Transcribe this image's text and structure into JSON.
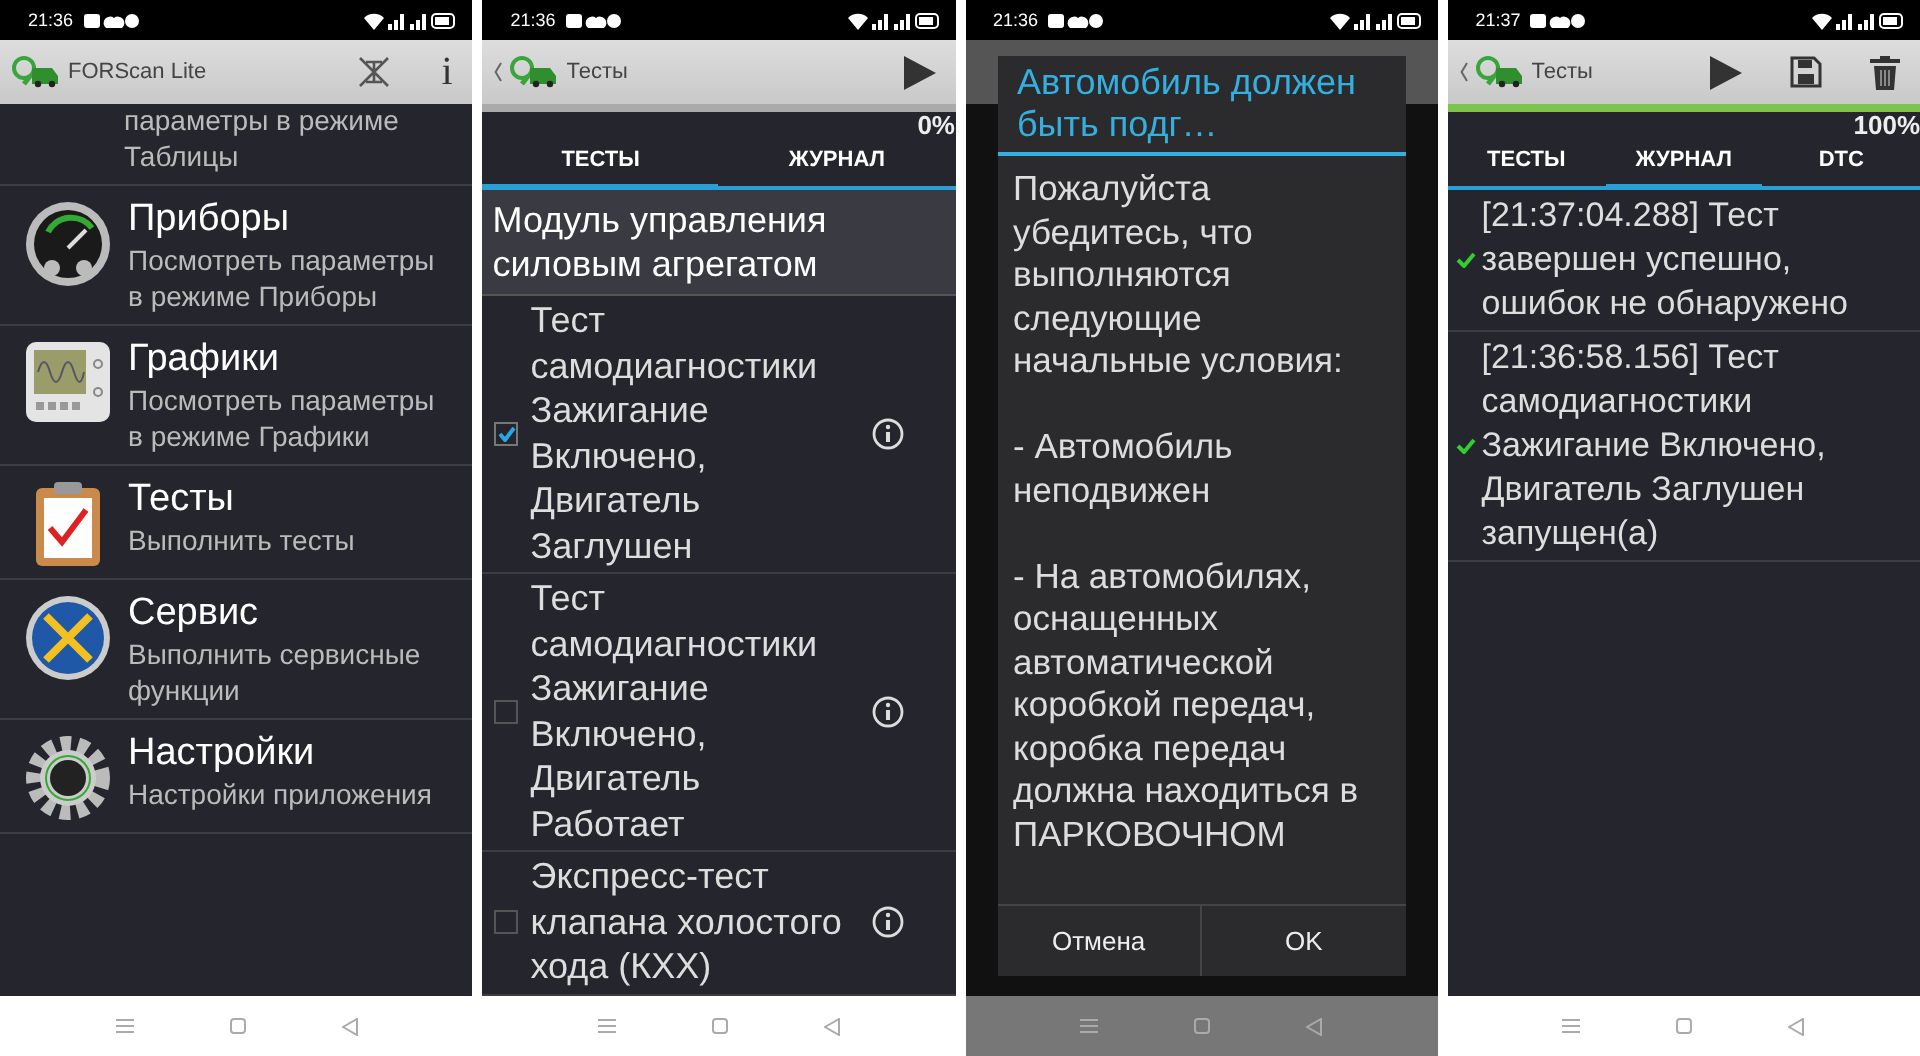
{
  "screens": [
    {
      "kind": "menu",
      "status_bar": {
        "time": "21:36"
      },
      "app_bar": {
        "title": "FORScan Lite",
        "info": "i"
      },
      "cut_text": "параметры в режиме Таблицы",
      "menu_items": [
        {
          "kind": "gauge",
          "title": "Приборы",
          "desc": "Посмотреть параметры в режиме Приборы"
        },
        {
          "kind": "scope",
          "title": "Графики",
          "desc": "Посмотреть параметры в режиме Графики"
        },
        {
          "kind": "clipboard",
          "title": "Тесты",
          "desc": "Выполнить тесты"
        },
        {
          "kind": "tools",
          "title": "Сервис",
          "desc": "Выполнить сервисные функции"
        },
        {
          "kind": "gear",
          "title": "Настройки",
          "desc": "Настройки приложения"
        }
      ]
    },
    {
      "kind": "tests",
      "status_bar": {
        "time": "21:36"
      },
      "app_bar": {
        "title": "Тесты"
      },
      "progress": {
        "level": 0,
        "reading": "0%"
      },
      "tabs": [
        {
          "label": "ТЕСТЫ",
          "selected": true
        },
        {
          "label": "ЖУРНАЛ",
          "selected": false
        }
      ],
      "group": "Модуль управления силовым агрегатом",
      "tests": [
        {
          "text": "Тест самодиагностики Зажигание Включено, Двигатель Заглушен",
          "checked": true
        },
        {
          "text": "Тест самодиагностики Зажигание Включено, Двигатель Работает",
          "checked": false
        },
        {
          "text": " Экспресс-тест клапана холостого хода (КХХ)",
          "checked": false
        }
      ]
    },
    {
      "kind": "dialog",
      "status_bar": {
        "time": "21:36"
      },
      "dialog": {
        "title": "Автомобиль должен быть подг…",
        "message": "Пожалуйста убедитесь, что выполняются следующие начальные условия:\n\n- Автомобиль неподвижен\n\n- На автомобилях, оснащенных автоматической коробкой передач, коробка передач должна находиться в ПАРКОВОЧНОМ",
        "buttons": [
          "Отмена",
          "OK"
        ]
      }
    },
    {
      "kind": "log",
      "status_bar": {
        "time": "21:37"
      },
      "app_bar": {
        "title": "Тесты"
      },
      "progress": {
        "level": 1,
        "reading": "100%"
      },
      "tabs": [
        {
          "label": "ТЕСТЫ",
          "selected": false
        },
        {
          "label": "ЖУРНАЛ",
          "selected": true
        },
        {
          "label": "DTC",
          "selected": false
        }
      ],
      "log": [
        {
          "text": "[21:37:04.288] Тест завершен успешно, ошибок не обнаружено",
          "ok": true
        },
        {
          "text": "[21:36:58.156] Тест самодиагностики Зажигание Включено, Двигатель Заглушен запущен(а)",
          "ok": true
        }
      ]
    }
  ]
}
